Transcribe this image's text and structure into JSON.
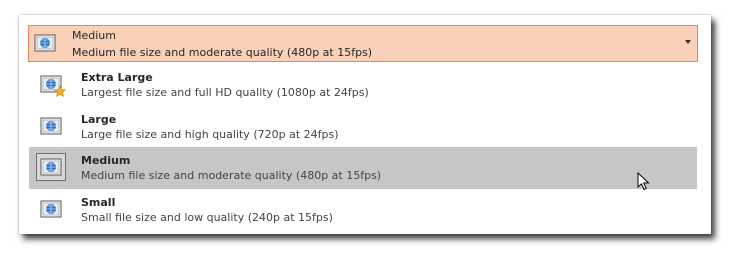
{
  "selected": {
    "title": "Medium",
    "description": "Medium file size and moderate quality (480p at 15fps)"
  },
  "options": [
    {
      "title": "Extra Large",
      "description": "Largest file size and full HD quality (1080p at 24fps)",
      "icon": "video-quality-star-icon"
    },
    {
      "title": "Large",
      "description": "Large file size and high quality (720p at 24fps)",
      "icon": "video-quality-icon"
    },
    {
      "title": "Medium",
      "description": "Medium file size and moderate quality (480p at 15fps)",
      "icon": "video-quality-icon"
    },
    {
      "title": "Small",
      "description": "Small file size and low quality (240p at 15fps)",
      "icon": "video-quality-icon"
    }
  ],
  "colors": {
    "selector_bg": "#fbd0b9",
    "selector_border": "#e6875a",
    "hover_bg": "#c6c6c6",
    "icon_blue": "#2f6fc4"
  }
}
